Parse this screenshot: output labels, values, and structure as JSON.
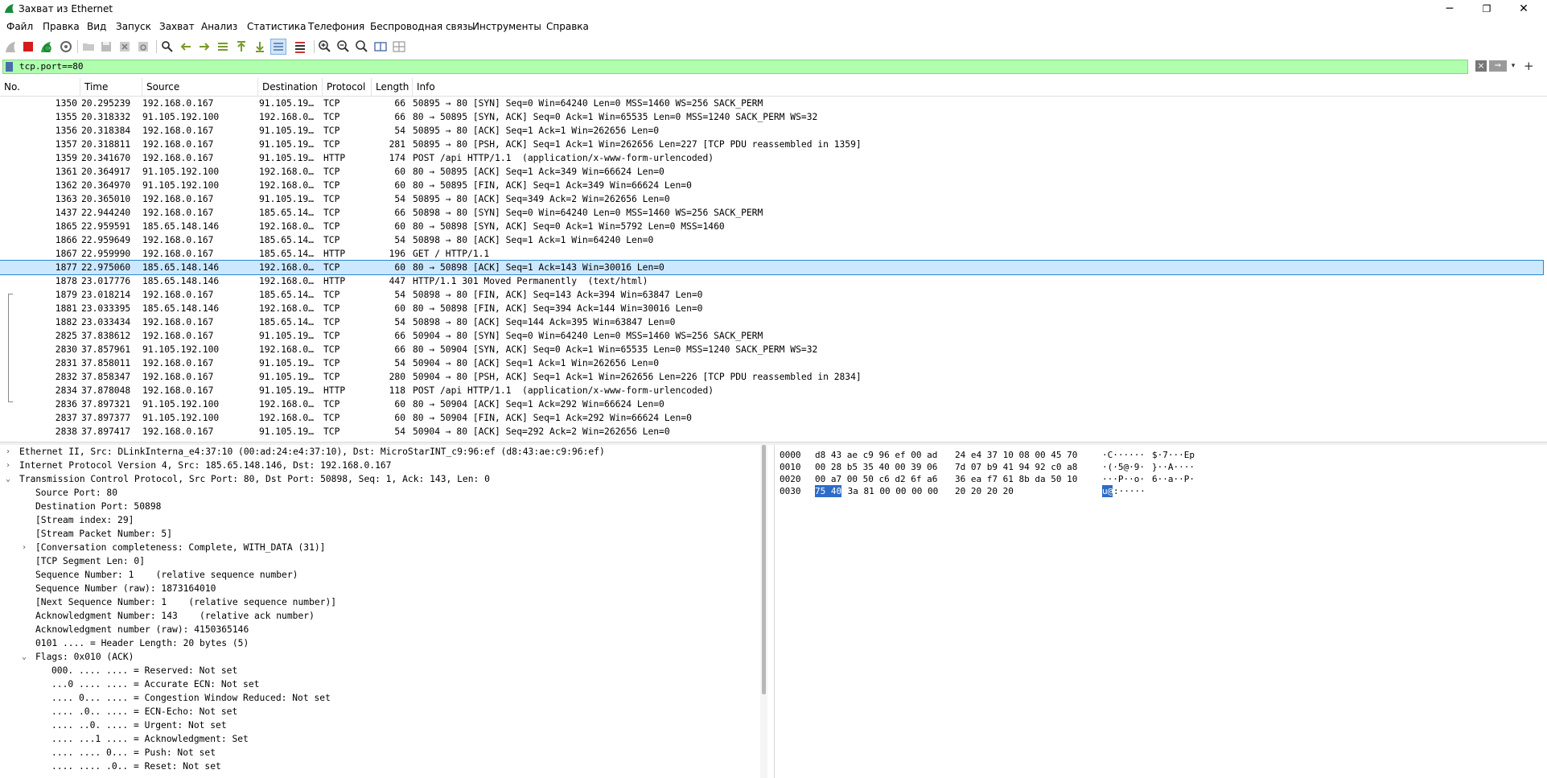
{
  "window": {
    "title": "Захват из Ethernet",
    "minimize": "─",
    "maximize": "❐",
    "close": "✕"
  },
  "menu": [
    "Файл",
    "Правка",
    "Вид",
    "Запуск",
    "Захват",
    "Анализ",
    "Статистика",
    "Телефония",
    "Беспроводная связь",
    "Инструменты",
    "Справка"
  ],
  "filter": {
    "value": "tcp.port==80",
    "clear_icon": "×",
    "apply_icon": "⇒",
    "dropdown_icon": "▾",
    "add_icon": "+"
  },
  "packet_list": {
    "columns": [
      "No.",
      "Time",
      "Source",
      "Destination",
      "Protocol",
      "Length",
      "Info"
    ],
    "rows": [
      {
        "no": "1350",
        "time": "20.295239",
        "src": "192.168.0.167",
        "dst": "91.105.19…",
        "proto": "TCP",
        "len": "66",
        "info": "50895 → 80 [SYN] Seq=0 Win=64240 Len=0 MSS=1460 WS=256 SACK_PERM"
      },
      {
        "no": "1355",
        "time": "20.318332",
        "src": "91.105.192.100",
        "dst": "192.168.0…",
        "proto": "TCP",
        "len": "66",
        "info": "80 → 50895 [SYN, ACK] Seq=0 Ack=1 Win=65535 Len=0 MSS=1240 SACK_PERM WS=32"
      },
      {
        "no": "1356",
        "time": "20.318384",
        "src": "192.168.0.167",
        "dst": "91.105.19…",
        "proto": "TCP",
        "len": "54",
        "info": "50895 → 80 [ACK] Seq=1 Ack=1 Win=262656 Len=0"
      },
      {
        "no": "1357",
        "time": "20.318811",
        "src": "192.168.0.167",
        "dst": "91.105.19…",
        "proto": "TCP",
        "len": "281",
        "info": "50895 → 80 [PSH, ACK] Seq=1 Ack=1 Win=262656 Len=227 [TCP PDU reassembled in 1359]"
      },
      {
        "no": "1359",
        "time": "20.341670",
        "src": "192.168.0.167",
        "dst": "91.105.19…",
        "proto": "HTTP",
        "len": "174",
        "info": "POST /api HTTP/1.1  (application/x-www-form-urlencoded)"
      },
      {
        "no": "1361",
        "time": "20.364917",
        "src": "91.105.192.100",
        "dst": "192.168.0…",
        "proto": "TCP",
        "len": "60",
        "info": "80 → 50895 [ACK] Seq=1 Ack=349 Win=66624 Len=0"
      },
      {
        "no": "1362",
        "time": "20.364970",
        "src": "91.105.192.100",
        "dst": "192.168.0…",
        "proto": "TCP",
        "len": "60",
        "info": "80 → 50895 [FIN, ACK] Seq=1 Ack=349 Win=66624 Len=0"
      },
      {
        "no": "1363",
        "time": "20.365010",
        "src": "192.168.0.167",
        "dst": "91.105.19…",
        "proto": "TCP",
        "len": "54",
        "info": "50895 → 80 [ACK] Seq=349 Ack=2 Win=262656 Len=0"
      },
      {
        "no": "1437",
        "time": "22.944240",
        "src": "192.168.0.167",
        "dst": "185.65.14…",
        "proto": "TCP",
        "len": "66",
        "info": "50898 → 80 [SYN] Seq=0 Win=64240 Len=0 MSS=1460 WS=256 SACK_PERM"
      },
      {
        "no": "1865",
        "time": "22.959591",
        "src": "185.65.148.146",
        "dst": "192.168.0…",
        "proto": "TCP",
        "len": "60",
        "info": "80 → 50898 [SYN, ACK] Seq=0 Ack=1 Win=5792 Len=0 MSS=1460"
      },
      {
        "no": "1866",
        "time": "22.959649",
        "src": "192.168.0.167",
        "dst": "185.65.14…",
        "proto": "TCP",
        "len": "54",
        "info": "50898 → 80 [ACK] Seq=1 Ack=1 Win=64240 Len=0"
      },
      {
        "no": "1867",
        "time": "22.959990",
        "src": "192.168.0.167",
        "dst": "185.65.14…",
        "proto": "HTTP",
        "len": "196",
        "info": "GET / HTTP/1.1"
      },
      {
        "no": "1877",
        "time": "22.975060",
        "src": "185.65.148.146",
        "dst": "192.168.0…",
        "proto": "TCP",
        "len": "60",
        "info": "80 → 50898 [ACK] Seq=1 Ack=143 Win=30016 Len=0"
      },
      {
        "no": "1878",
        "time": "23.017776",
        "src": "185.65.148.146",
        "dst": "192.168.0…",
        "proto": "HTTP",
        "len": "447",
        "info": "HTTP/1.1 301 Moved Permanently  (text/html)"
      },
      {
        "no": "1879",
        "time": "23.018214",
        "src": "192.168.0.167",
        "dst": "185.65.14…",
        "proto": "TCP",
        "len": "54",
        "info": "50898 → 80 [FIN, ACK] Seq=143 Ack=394 Win=63847 Len=0"
      },
      {
        "no": "1881",
        "time": "23.033395",
        "src": "185.65.148.146",
        "dst": "192.168.0…",
        "proto": "TCP",
        "len": "60",
        "info": "80 → 50898 [FIN, ACK] Seq=394 Ack=144 Win=30016 Len=0"
      },
      {
        "no": "1882",
        "time": "23.033434",
        "src": "192.168.0.167",
        "dst": "185.65.14…",
        "proto": "TCP",
        "len": "54",
        "info": "50898 → 80 [ACK] Seq=144 Ack=395 Win=63847 Len=0"
      },
      {
        "no": "2825",
        "time": "37.838612",
        "src": "192.168.0.167",
        "dst": "91.105.19…",
        "proto": "TCP",
        "len": "66",
        "info": "50904 → 80 [SYN] Seq=0 Win=64240 Len=0 MSS=1460 WS=256 SACK_PERM"
      },
      {
        "no": "2830",
        "time": "37.857961",
        "src": "91.105.192.100",
        "dst": "192.168.0…",
        "proto": "TCP",
        "len": "66",
        "info": "80 → 50904 [SYN, ACK] Seq=0 Ack=1 Win=65535 Len=0 MSS=1240 SACK_PERM WS=32"
      },
      {
        "no": "2831",
        "time": "37.858011",
        "src": "192.168.0.167",
        "dst": "91.105.19…",
        "proto": "TCP",
        "len": "54",
        "info": "50904 → 80 [ACK] Seq=1 Ack=1 Win=262656 Len=0"
      },
      {
        "no": "2832",
        "time": "37.858347",
        "src": "192.168.0.167",
        "dst": "91.105.19…",
        "proto": "TCP",
        "len": "280",
        "info": "50904 → 80 [PSH, ACK] Seq=1 Ack=1 Win=262656 Len=226 [TCP PDU reassembled in 2834]"
      },
      {
        "no": "2834",
        "time": "37.878048",
        "src": "192.168.0.167",
        "dst": "91.105.19…",
        "proto": "HTTP",
        "len": "118",
        "info": "POST /api HTTP/1.1  (application/x-www-form-urlencoded)"
      },
      {
        "no": "2836",
        "time": "37.897321",
        "src": "91.105.192.100",
        "dst": "192.168.0…",
        "proto": "TCP",
        "len": "60",
        "info": "80 → 50904 [ACK] Seq=1 Ack=292 Win=66624 Len=0"
      },
      {
        "no": "2837",
        "time": "37.897377",
        "src": "91.105.192.100",
        "dst": "192.168.0…",
        "proto": "TCP",
        "len": "60",
        "info": "80 → 50904 [FIN, ACK] Seq=1 Ack=292 Win=66624 Len=0"
      },
      {
        "no": "2838",
        "time": "37.897417",
        "src": "192.168.0.167",
        "dst": "91.105.19…",
        "proto": "TCP",
        "len": "54",
        "info": "50904 → 80 [ACK] Seq=292 Ack=2 Win=262656 Len=0"
      }
    ],
    "selected_no": "1877"
  },
  "details": [
    {
      "indent": 0,
      "arrow": "›",
      "text": "Ethernet II, Src: DLinkInterna_e4:37:10 (00:ad:24:e4:37:10), Dst: MicroStarINT_c9:96:ef (d8:43:ae:c9:96:ef)"
    },
    {
      "indent": 0,
      "arrow": "›",
      "text": "Internet Protocol Version 4, Src: 185.65.148.146, Dst: 192.168.0.167"
    },
    {
      "indent": 0,
      "arrow": "⌄",
      "text": "Transmission Control Protocol, Src Port: 80, Dst Port: 50898, Seq: 1, Ack: 143, Len: 0"
    },
    {
      "indent": 1,
      "arrow": "",
      "text": "Source Port: 80"
    },
    {
      "indent": 1,
      "arrow": "",
      "text": "Destination Port: 50898"
    },
    {
      "indent": 1,
      "arrow": "",
      "text": "[Stream index: 29]"
    },
    {
      "indent": 1,
      "arrow": "",
      "text": "[Stream Packet Number: 5]"
    },
    {
      "indent": 1,
      "arrow": "›",
      "text": "[Conversation completeness: Complete, WITH_DATA (31)]"
    },
    {
      "indent": 1,
      "arrow": "",
      "text": "[TCP Segment Len: 0]"
    },
    {
      "indent": 1,
      "arrow": "",
      "text": "Sequence Number: 1    (relative sequence number)"
    },
    {
      "indent": 1,
      "arrow": "",
      "text": "Sequence Number (raw): 1873164010"
    },
    {
      "indent": 1,
      "arrow": "",
      "text": "[Next Sequence Number: 1    (relative sequence number)]"
    },
    {
      "indent": 1,
      "arrow": "",
      "text": "Acknowledgment Number: 143    (relative ack number)"
    },
    {
      "indent": 1,
      "arrow": "",
      "text": "Acknowledgment number (raw): 4150365146"
    },
    {
      "indent": 1,
      "arrow": "",
      "text": "0101 .... = Header Length: 20 bytes (5)"
    },
    {
      "indent": 1,
      "arrow": "⌄",
      "text": "Flags: 0x010 (ACK)"
    },
    {
      "indent": 2,
      "arrow": "",
      "text": "000. .... .... = Reserved: Not set"
    },
    {
      "indent": 2,
      "arrow": "",
      "text": "...0 .... .... = Accurate ECN: Not set"
    },
    {
      "indent": 2,
      "arrow": "",
      "text": ".... 0... .... = Congestion Window Reduced: Not set"
    },
    {
      "indent": 2,
      "arrow": "",
      "text": ".... .0.. .... = ECN-Echo: Not set"
    },
    {
      "indent": 2,
      "arrow": "",
      "text": ".... ..0. .... = Urgent: Not set"
    },
    {
      "indent": 2,
      "arrow": "",
      "text": ".... ...1 .... = Acknowledgment: Set"
    },
    {
      "indent": 2,
      "arrow": "",
      "text": ".... .... 0... = Push: Not set"
    },
    {
      "indent": 2,
      "arrow": "",
      "text": ".... .... .0.. = Reset: Not set"
    }
  ],
  "bytes": [
    {
      "offset": "0000",
      "hex1": "d8 43 ae c9 96 ef 00 ad",
      "hex2": "24 e4 37 10 08 00 45 70",
      "ascii1": "·C······",
      "ascii2": "$·7···Ep"
    },
    {
      "offset": "0010",
      "hex1": "00 28 b5 35 40 00 39 06",
      "hex2": "7d 07 b9 41 94 92 c0 a8",
      "ascii1": "·(·5@·9·",
      "ascii2": "}··A····"
    },
    {
      "offset": "0020",
      "hex1": "00 a7 00 50 c6 d2 6f a6",
      "hex2": "36 ea f7 61 8b da 50 10",
      "ascii1": "···P··o·",
      "ascii2": "6··a··P·"
    },
    {
      "offset": "0030",
      "hex_hl": "75 40",
      "hex1_rest": " 3a 81 00 00 00 00",
      "hex2": "20 20 20 20",
      "ascii_hl": "u@",
      "ascii1_rest": ":·····",
      "ascii2": ""
    }
  ]
}
